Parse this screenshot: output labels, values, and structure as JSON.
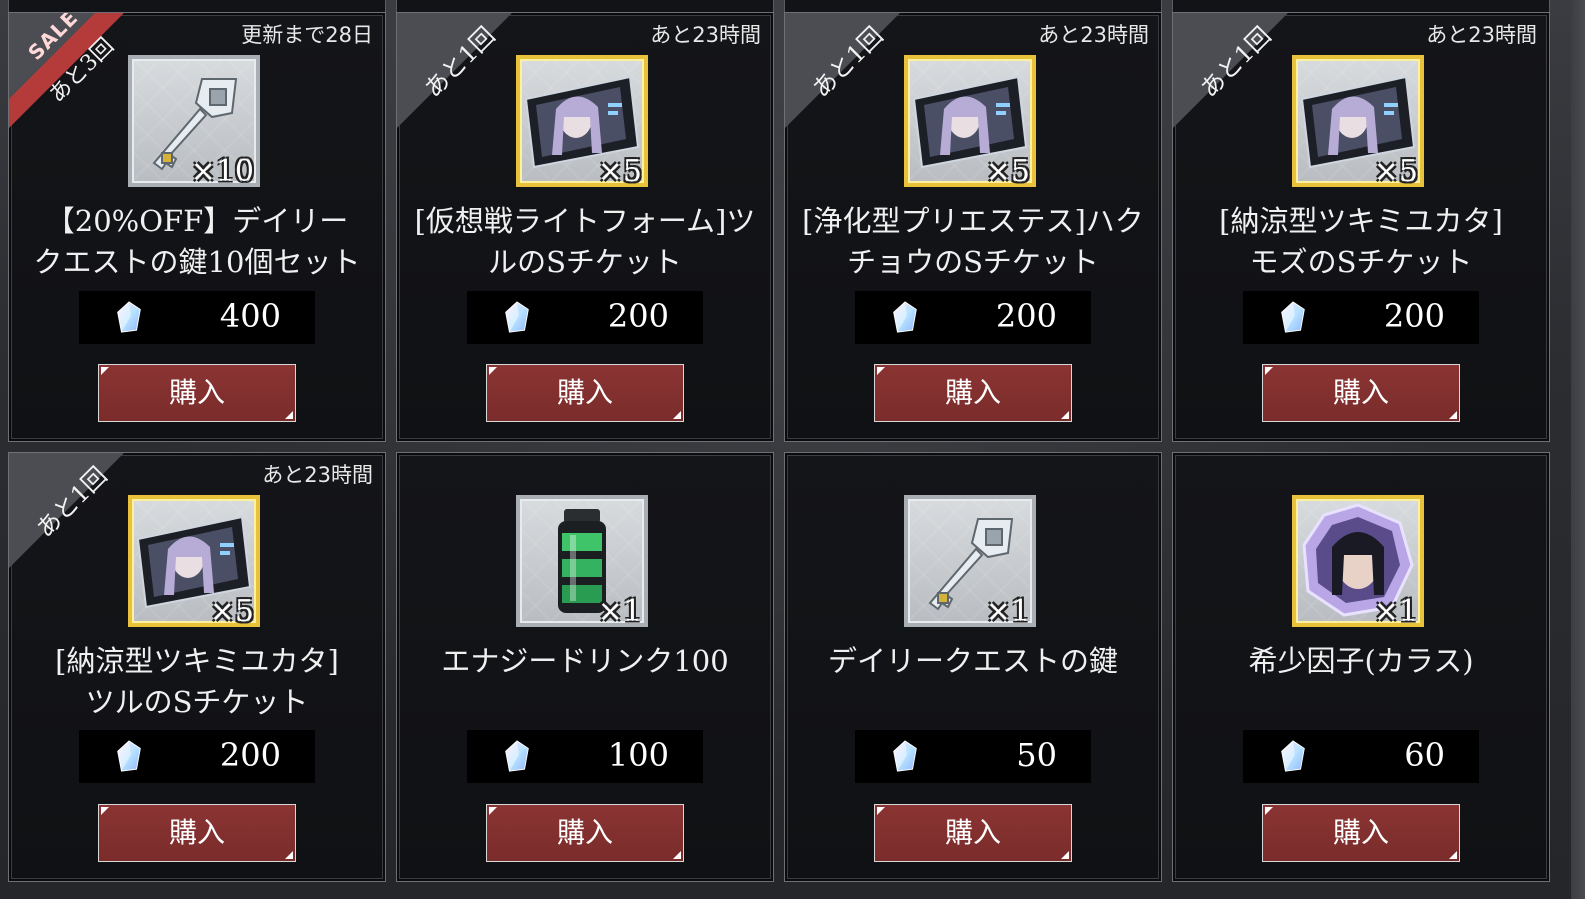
{
  "cards": [
    {
      "badge": "あと3回",
      "sale": "SALE",
      "timer": "更新まで28日",
      "icon": "key-icon",
      "frame": "silver",
      "quantity": "×10",
      "name": "【20%OFF】デイリー\nクエストの鍵10個セット",
      "price": "400",
      "buy": "購入"
    },
    {
      "badge": "あと1回",
      "timer": "あと23時間",
      "icon": "character-ticket-icon",
      "frame": "gold",
      "quantity": "×5",
      "name": "[仮想戦ライトフォーム]ツ\nルのSチケット",
      "price": "200",
      "buy": "購入"
    },
    {
      "badge": "あと1回",
      "timer": "あと23時間",
      "icon": "character-ticket-icon",
      "frame": "gold",
      "quantity": "×5",
      "name": "[浄化型プリエステス]ハク\nチョウのSチケット",
      "price": "200",
      "buy": "購入"
    },
    {
      "badge": "あと1回",
      "timer": "あと23時間",
      "icon": "character-ticket-icon",
      "frame": "gold",
      "quantity": "×5",
      "name": "[納涼型ツキミユカタ]\nモズのSチケット",
      "price": "200",
      "buy": "購入"
    },
    {
      "badge": "あと1回",
      "timer": "あと23時間",
      "icon": "character-ticket-icon",
      "frame": "gold",
      "quantity": "×5",
      "name": "[納涼型ツキミユカタ]\nツルのSチケット",
      "price": "200",
      "buy": "購入"
    },
    {
      "icon": "energy-drink-icon",
      "frame": "silver",
      "quantity": "×1",
      "name": "エナジードリンク100",
      "price": "100",
      "buy": "購入"
    },
    {
      "icon": "key-icon",
      "frame": "silver",
      "quantity": "×1",
      "name": "デイリークエストの鍵",
      "price": "50",
      "buy": "購入"
    },
    {
      "icon": "rare-factor-crystal-icon",
      "frame": "gold",
      "quantity": "×1",
      "name": "希少因子(カラス)",
      "price": "60",
      "buy": "購入"
    }
  ],
  "currency_icon": "gem-icon",
  "colors": {
    "buy_button": "#8a3433",
    "sale_badge": "#b53a3a",
    "gold_frame": "#e7c23a",
    "silver_frame": "#a8aeb4"
  }
}
